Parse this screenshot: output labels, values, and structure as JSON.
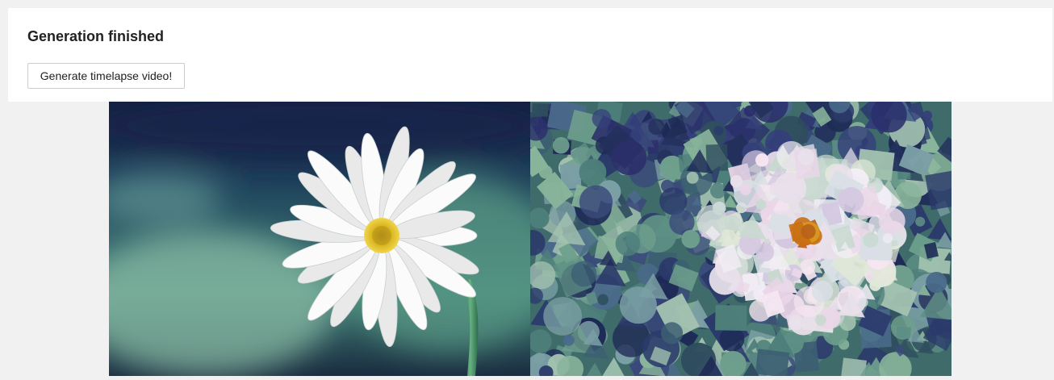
{
  "panel": {
    "title": "Generation finished",
    "button_label": "Generate timelapse video!"
  },
  "images": {
    "original": {
      "icon": "daisy-photo",
      "colors": {
        "background_dark": "#14213d",
        "background_mid": "#3f6f6f",
        "background_light": "#8fc1a8",
        "petal": "#f4f4f4",
        "center": "#d7b21b",
        "stem": "#3f8a5a"
      }
    },
    "generated": {
      "icon": "daisy-shape-approximation",
      "colors": {
        "background_dark": "#1e2a56",
        "background_mid": "#4e7f7a",
        "background_light": "#89b59b",
        "petal": "#e8e0ea",
        "center": "#c96f14"
      }
    }
  }
}
